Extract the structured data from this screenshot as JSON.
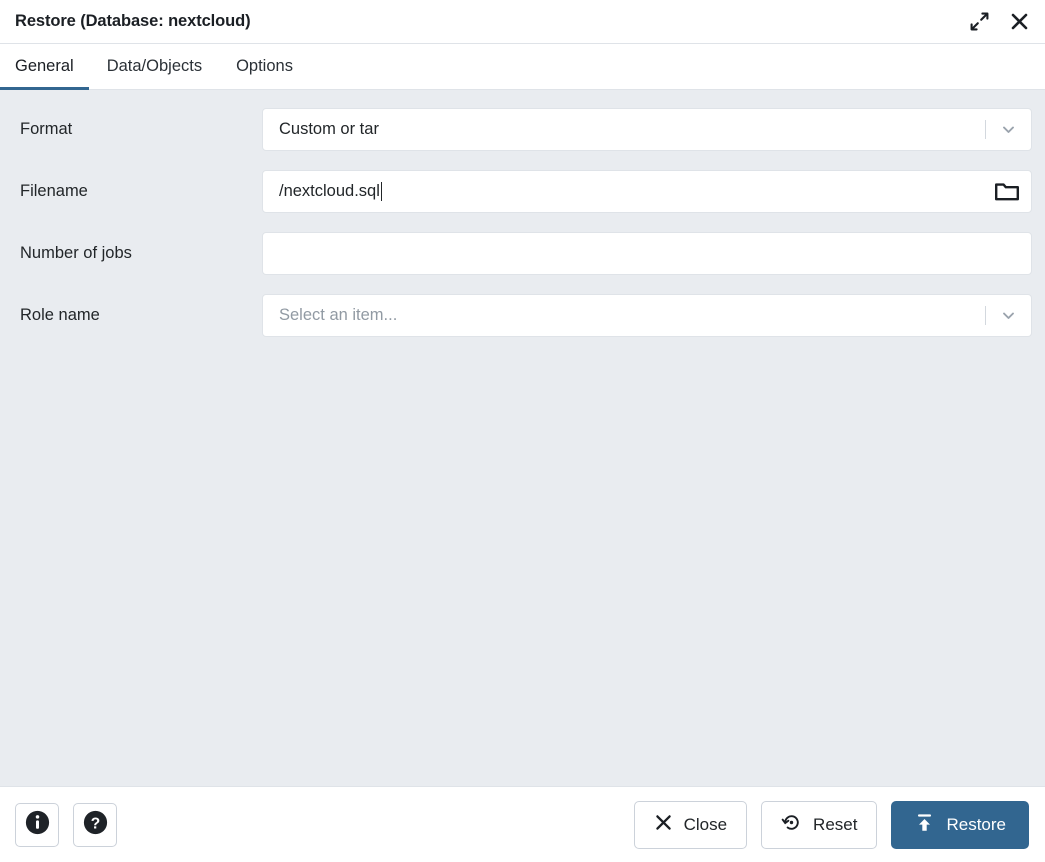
{
  "window": {
    "title": "Restore (Database: nextcloud)",
    "expand_icon": "expand-diagonal-icon",
    "close_icon": "close-icon"
  },
  "tabs": [
    {
      "label": "General",
      "active": true
    },
    {
      "label": "Data/Objects",
      "active": false
    },
    {
      "label": "Options",
      "active": false
    }
  ],
  "form": {
    "format": {
      "label": "Format",
      "value": "Custom or tar",
      "type": "select",
      "icon": "chevron-down-icon"
    },
    "filename": {
      "label": "Filename",
      "value": "/nextcloud.sql",
      "placeholder": "",
      "type": "text",
      "icon": "folder-icon",
      "focused": true
    },
    "number_of_jobs": {
      "label": "Number of jobs",
      "value": "",
      "placeholder": "",
      "type": "text"
    },
    "role_name": {
      "label": "Role name",
      "value": "",
      "placeholder": "Select an item...",
      "type": "select",
      "icon": "chevron-down-icon"
    }
  },
  "footer": {
    "info_button": "info-icon",
    "help_button": "help-icon",
    "close_label": "Close",
    "reset_label": "Reset",
    "restore_label": "Restore"
  },
  "colors": {
    "accent": "#326690",
    "body_background": "#e9ecf0",
    "surface": "#ffffff",
    "border": "#dfe3e8",
    "text": "#222629",
    "placeholder": "#919aa3"
  }
}
